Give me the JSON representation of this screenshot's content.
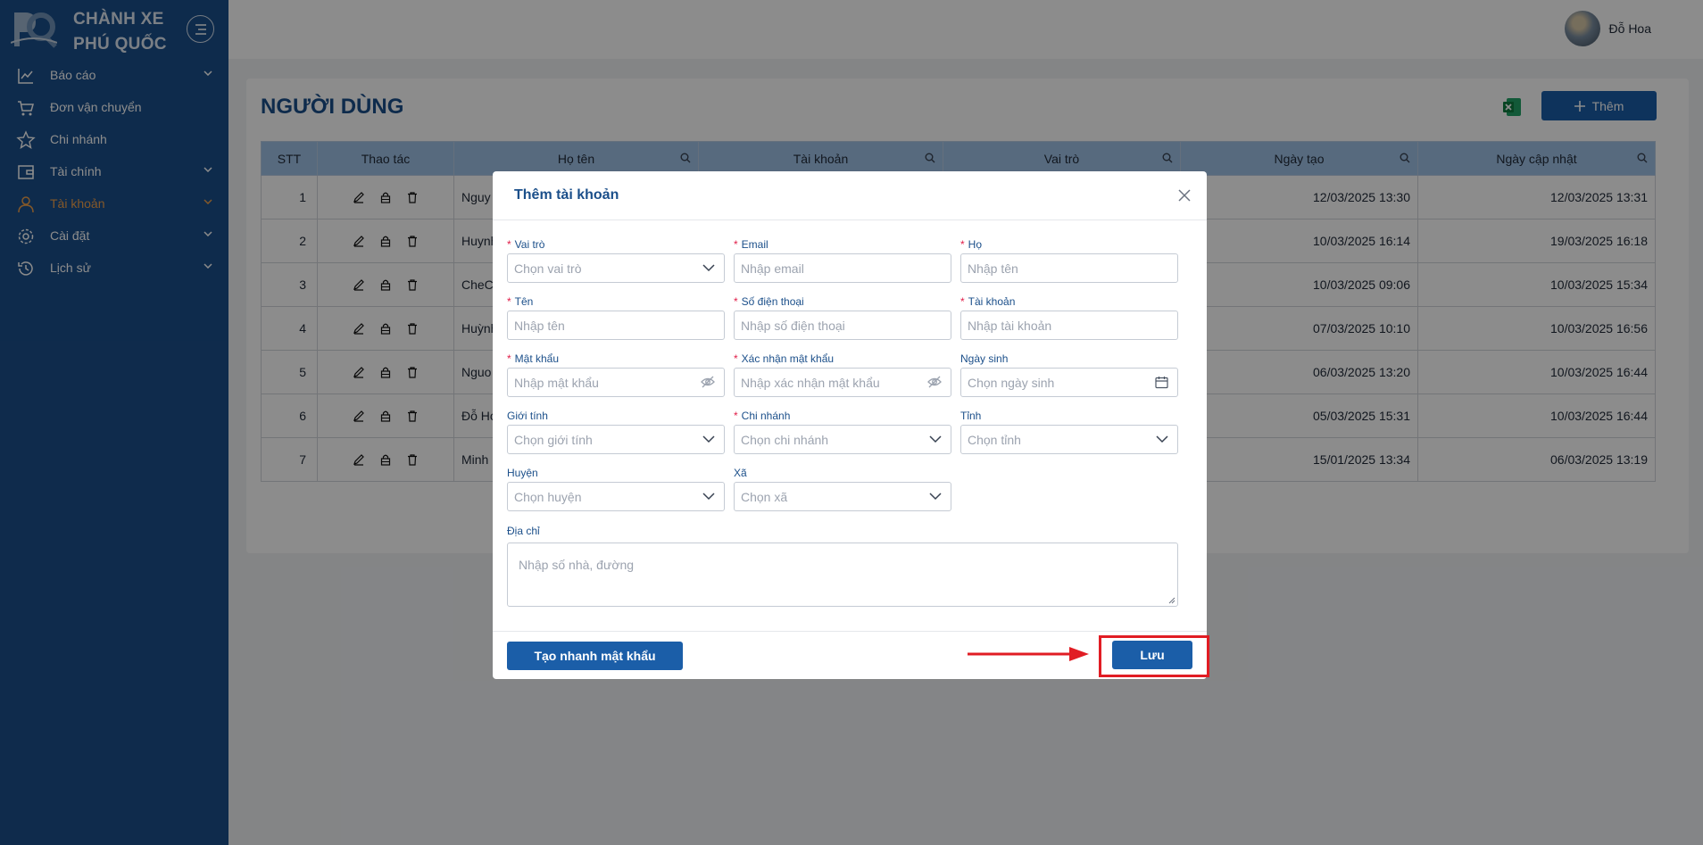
{
  "brand": {
    "line1": "CHÀNH XE",
    "line2": "PHÚ QUỐC",
    "logo_text": "PQ"
  },
  "sidebar": {
    "items": [
      {
        "label": "Báo cáo",
        "icon": "line-chart-icon",
        "has_children": true
      },
      {
        "label": "Đơn vận chuyển",
        "icon": "cart-icon",
        "has_children": false
      },
      {
        "label": "Chi nhánh",
        "icon": "star-icon",
        "has_children": false
      },
      {
        "label": "Tài chính",
        "icon": "wallet-icon",
        "has_children": true
      },
      {
        "label": "Tài khoản",
        "icon": "user-icon",
        "has_children": true,
        "active": true
      },
      {
        "label": "Cài đặt",
        "icon": "gear-icon",
        "has_children": true
      },
      {
        "label": "Lịch sử",
        "icon": "history-icon",
        "has_children": true
      }
    ]
  },
  "header": {
    "user_name": "Đỗ Hoa"
  },
  "page": {
    "title": "NGƯỜI DÙNG",
    "add_label": "Thêm"
  },
  "table": {
    "columns": [
      "STT",
      "Thao tác",
      "Họ tên",
      "Tài khoản",
      "Vai trò",
      "Ngày tạo",
      "Ngày cập nhật"
    ],
    "rows": [
      {
        "stt": "1",
        "name": "Nguy",
        "created": "12/03/2025 13:30",
        "updated": "12/03/2025 13:31"
      },
      {
        "stt": "2",
        "name": "Huynh",
        "created": "10/03/2025 16:14",
        "updated": "19/03/2025 16:18"
      },
      {
        "stt": "3",
        "name": "CheCh",
        "created": "10/03/2025 09:06",
        "updated": "10/03/2025 15:34"
      },
      {
        "stt": "4",
        "name": "Huỳnh",
        "created": "07/03/2025 10:10",
        "updated": "10/03/2025 16:56"
      },
      {
        "stt": "5",
        "name": "Nguo",
        "created": "06/03/2025 13:20",
        "updated": "10/03/2025 16:44"
      },
      {
        "stt": "6",
        "name": "Đỗ Ho",
        "created": "05/03/2025 15:31",
        "updated": "10/03/2025 16:44"
      },
      {
        "stt": "7",
        "name": "Minh",
        "created": "15/01/2025 13:34",
        "updated": "06/03/2025 13:19"
      }
    ]
  },
  "modal": {
    "title": "Thêm tài khoản",
    "fields": {
      "role": {
        "label": "Vai trò",
        "placeholder": "Chọn vai trò"
      },
      "email": {
        "label": "Email",
        "placeholder": "Nhập email"
      },
      "last_name": {
        "label": "Họ",
        "placeholder": "Nhập tên"
      },
      "first_name": {
        "label": "Tên",
        "placeholder": "Nhập tên"
      },
      "phone": {
        "label": "Số điện thoại",
        "placeholder": "Nhập số điện thoại"
      },
      "username": {
        "label": "Tài khoản",
        "placeholder": "Nhập tài khoản"
      },
      "password": {
        "label": "Mật khẩu",
        "placeholder": "Nhập mật khẩu"
      },
      "confirm_password": {
        "label": "Xác nhận mật khẩu",
        "placeholder": "Nhập xác nhận mật khẩu"
      },
      "birthday": {
        "label": "Ngày sinh",
        "placeholder": "Chọn ngày sinh"
      },
      "gender": {
        "label": "Giới tính",
        "placeholder": "Chọn giới tính"
      },
      "branch": {
        "label": "Chi nhánh",
        "placeholder": "Chọn chi nhánh"
      },
      "province": {
        "label": "Tỉnh",
        "placeholder": "Chọn tỉnh"
      },
      "district": {
        "label": "Huyện",
        "placeholder": "Chọn huyện"
      },
      "ward": {
        "label": "Xã",
        "placeholder": "Chọn xã"
      },
      "address": {
        "label": "Địa chỉ",
        "placeholder": "Nhập số nhà, đường"
      }
    },
    "generate_password_label": "Tạo nhanh mật khẩu",
    "save_label": "Lưu"
  },
  "colors": {
    "sidebar": "#1b4f8a",
    "primary": "#1b5ea8",
    "active": "#f0a04b",
    "highlight": "#e11d24"
  }
}
